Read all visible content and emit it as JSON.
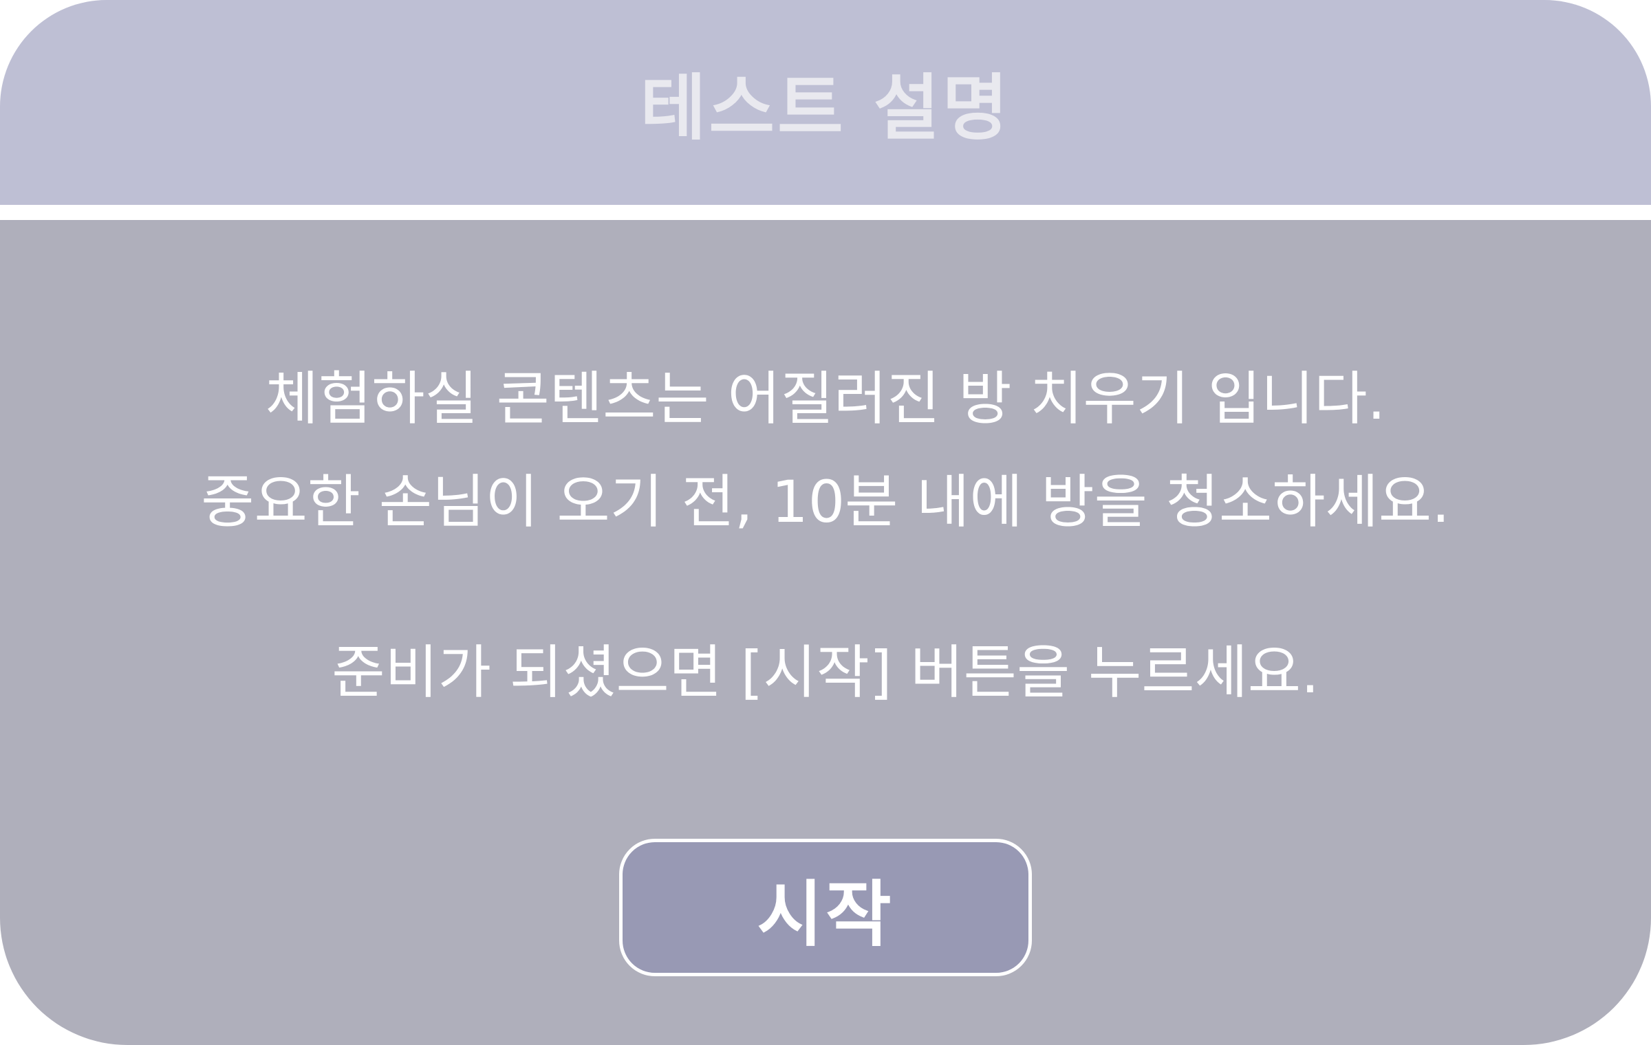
{
  "dialog": {
    "title": "테스트 설명",
    "message_lines": [
      "체험하실 콘텐츠는 어질러진 방 치우기 입니다.",
      "중요한 손님이 오기 전, 10분 내에 방을 청소하세요.",
      "준비가 되셨으면 [시작] 버튼을 누르세요."
    ],
    "start_button_label": "시작"
  },
  "colors": {
    "header_bg": "#bebfd4",
    "body_bg": "#afafbb",
    "button_bg": "#9899b4",
    "text": "#ffffff"
  }
}
